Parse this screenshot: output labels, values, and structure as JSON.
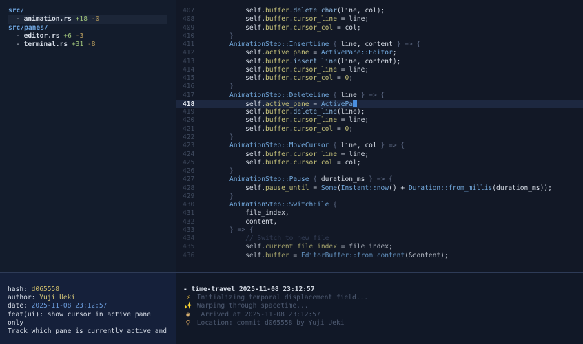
{
  "file_tree": [
    {
      "type": "dir",
      "name": "src/"
    },
    {
      "type": "file",
      "name": "animation.rs",
      "added": "+18",
      "removed": "-0",
      "selected": true
    },
    {
      "type": "dir",
      "name": "src/panes/"
    },
    {
      "type": "file",
      "name": "editor.rs",
      "added": "+6",
      "removed": "-3",
      "selected": false
    },
    {
      "type": "file",
      "name": "terminal.rs",
      "added": "+31",
      "removed": "-8",
      "selected": false
    }
  ],
  "tree_dash": "- ",
  "editor": {
    "current_line": "418",
    "lines": [
      {
        "n": "407",
        "i": 16,
        "t": [
          [
            "k",
            "self"
          ],
          [
            "p",
            "."
          ],
          [
            "f",
            "buffer"
          ],
          [
            "p",
            "."
          ],
          [
            "m",
            "delete_char"
          ],
          [
            "p",
            "(line, col);"
          ]
        ]
      },
      {
        "n": "408",
        "i": 16,
        "t": [
          [
            "k",
            "self"
          ],
          [
            "p",
            "."
          ],
          [
            "f",
            "buffer"
          ],
          [
            "p",
            "."
          ],
          [
            "f",
            "cursor_line"
          ],
          [
            "p",
            " = line;"
          ]
        ]
      },
      {
        "n": "409",
        "i": 16,
        "t": [
          [
            "k",
            "self"
          ],
          [
            "p",
            "."
          ],
          [
            "f",
            "buffer"
          ],
          [
            "p",
            "."
          ],
          [
            "f",
            "cursor_col"
          ],
          [
            "p",
            " = col;"
          ]
        ]
      },
      {
        "n": "410",
        "i": 12,
        "t": [
          [
            "d",
            "}"
          ]
        ]
      },
      {
        "n": "411",
        "i": 12,
        "t": [
          [
            "t",
            "AnimationStep::InsertLine"
          ],
          [
            "d",
            " { "
          ],
          [
            "p",
            "line, content"
          ],
          [
            "d",
            " } => {"
          ]
        ]
      },
      {
        "n": "412",
        "i": 16,
        "t": [
          [
            "k",
            "self"
          ],
          [
            "p",
            "."
          ],
          [
            "f",
            "active_pane"
          ],
          [
            "p",
            " = "
          ],
          [
            "t",
            "ActivePane::Editor"
          ],
          [
            "p",
            ";"
          ]
        ]
      },
      {
        "n": "413",
        "i": 16,
        "t": [
          [
            "k",
            "self"
          ],
          [
            "p",
            "."
          ],
          [
            "f",
            "buffer"
          ],
          [
            "p",
            "."
          ],
          [
            "m",
            "insert_line"
          ],
          [
            "p",
            "(line, content);"
          ]
        ]
      },
      {
        "n": "414",
        "i": 16,
        "t": [
          [
            "k",
            "self"
          ],
          [
            "p",
            "."
          ],
          [
            "f",
            "buffer"
          ],
          [
            "p",
            "."
          ],
          [
            "f",
            "cursor_line"
          ],
          [
            "p",
            " = line;"
          ]
        ]
      },
      {
        "n": "415",
        "i": 16,
        "t": [
          [
            "k",
            "self"
          ],
          [
            "p",
            "."
          ],
          [
            "f",
            "buffer"
          ],
          [
            "p",
            "."
          ],
          [
            "f",
            "cursor_col"
          ],
          [
            "p",
            " = "
          ],
          [
            "n",
            "0"
          ],
          [
            "p",
            ";"
          ]
        ]
      },
      {
        "n": "416",
        "i": 12,
        "t": [
          [
            "d",
            "}"
          ]
        ]
      },
      {
        "n": "417",
        "i": 12,
        "t": [
          [
            "t",
            "AnimationStep::DeleteLine"
          ],
          [
            "d",
            " { "
          ],
          [
            "p",
            "line"
          ],
          [
            "d",
            " } => {"
          ]
        ]
      },
      {
        "n": "418",
        "i": 16,
        "t": [
          [
            "k",
            "self"
          ],
          [
            "p",
            "."
          ],
          [
            "f",
            "active_pane"
          ],
          [
            "p",
            " = "
          ],
          [
            "t",
            "ActivePa"
          ]
        ],
        "cursor": true
      },
      {
        "n": "419",
        "i": 16,
        "t": [
          [
            "k",
            "self"
          ],
          [
            "p",
            "."
          ],
          [
            "f",
            "buffer"
          ],
          [
            "p",
            "."
          ],
          [
            "m",
            "delete_line"
          ],
          [
            "p",
            "(line);"
          ]
        ]
      },
      {
        "n": "420",
        "i": 16,
        "t": [
          [
            "k",
            "self"
          ],
          [
            "p",
            "."
          ],
          [
            "f",
            "buffer"
          ],
          [
            "p",
            "."
          ],
          [
            "f",
            "cursor_line"
          ],
          [
            "p",
            " = line;"
          ]
        ]
      },
      {
        "n": "421",
        "i": 16,
        "t": [
          [
            "k",
            "self"
          ],
          [
            "p",
            "."
          ],
          [
            "f",
            "buffer"
          ],
          [
            "p",
            "."
          ],
          [
            "f",
            "cursor_col"
          ],
          [
            "p",
            " = "
          ],
          [
            "n",
            "0"
          ],
          [
            "p",
            ";"
          ]
        ]
      },
      {
        "n": "422",
        "i": 12,
        "t": [
          [
            "d",
            "}"
          ]
        ]
      },
      {
        "n": "423",
        "i": 12,
        "t": [
          [
            "t",
            "AnimationStep::MoveCursor"
          ],
          [
            "d",
            " { "
          ],
          [
            "p",
            "line, col"
          ],
          [
            "d",
            " } => {"
          ]
        ]
      },
      {
        "n": "424",
        "i": 16,
        "t": [
          [
            "k",
            "self"
          ],
          [
            "p",
            "."
          ],
          [
            "f",
            "buffer"
          ],
          [
            "p",
            "."
          ],
          [
            "f",
            "cursor_line"
          ],
          [
            "p",
            " = line;"
          ]
        ]
      },
      {
        "n": "425",
        "i": 16,
        "t": [
          [
            "k",
            "self"
          ],
          [
            "p",
            "."
          ],
          [
            "f",
            "buffer"
          ],
          [
            "p",
            "."
          ],
          [
            "f",
            "cursor_col"
          ],
          [
            "p",
            " = col;"
          ]
        ]
      },
      {
        "n": "426",
        "i": 12,
        "t": [
          [
            "d",
            "}"
          ]
        ]
      },
      {
        "n": "427",
        "i": 12,
        "t": [
          [
            "t",
            "AnimationStep::Pause"
          ],
          [
            "d",
            " { "
          ],
          [
            "p",
            "duration_ms"
          ],
          [
            "d",
            " } => {"
          ]
        ]
      },
      {
        "n": "428",
        "i": 16,
        "t": [
          [
            "k",
            "self"
          ],
          [
            "p",
            "."
          ],
          [
            "f",
            "pause_until"
          ],
          [
            "p",
            " = "
          ],
          [
            "t",
            "Some"
          ],
          [
            "p",
            "("
          ],
          [
            "t",
            "Instant::now"
          ],
          [
            "p",
            "() + "
          ],
          [
            "t",
            "Duration::from_millis"
          ],
          [
            "p",
            "(duration_ms));"
          ]
        ]
      },
      {
        "n": "429",
        "i": 12,
        "t": [
          [
            "d",
            "}"
          ]
        ]
      },
      {
        "n": "430",
        "i": 12,
        "t": [
          [
            "t",
            "AnimationStep::SwitchFile"
          ],
          [
            "d",
            " {"
          ]
        ]
      },
      {
        "n": "431",
        "i": 16,
        "t": [
          [
            "p",
            "file_index,"
          ]
        ]
      },
      {
        "n": "432",
        "i": 16,
        "t": [
          [
            "p",
            "content,"
          ]
        ]
      },
      {
        "n": "433",
        "i": 12,
        "t": [
          [
            "d",
            "} => {"
          ]
        ]
      },
      {
        "n": "434",
        "i": 16,
        "t": [
          [
            "c",
            "// Switch to new file"
          ]
        ]
      },
      {
        "n": "435",
        "i": 16,
        "t": [
          [
            "k",
            "self"
          ],
          [
            "p",
            "."
          ],
          [
            "f",
            "current_file_index"
          ],
          [
            "p",
            " = file_index;"
          ]
        ]
      },
      {
        "n": "436",
        "i": 16,
        "t": [
          [
            "k",
            "self"
          ],
          [
            "p",
            "."
          ],
          [
            "f",
            "buffer"
          ],
          [
            "p",
            " = "
          ],
          [
            "t",
            "EditorBuffer::from_content"
          ],
          [
            "p",
            "(&content);"
          ]
        ]
      }
    ]
  },
  "commit": {
    "hash_label": "hash: ",
    "hash": "d065558",
    "author_label": "author: ",
    "author": "Yuji Ueki",
    "date_label": "date: ",
    "date": "2025-11-08 23:12:57",
    "subject_1": "feat(ui): show cursor in active pane",
    "subject_2": "only",
    "body": "Track which pane is currently active and"
  },
  "terminal": {
    "header": "- time-travel 2025-11-08 23:12:57",
    "lines": [
      {
        "icon": "bolt",
        "glyph": "⚡",
        "text": "Initializing temporal displacement field..."
      },
      {
        "icon": "sparkle",
        "glyph": "✨",
        "text": "Warping through spacetime..."
      },
      {
        "icon": "clock",
        "glyph": "◉",
        "text": " Arrived at 2025-11-08 23:12:57"
      },
      {
        "icon": "pin",
        "glyph": "⚲",
        "text": "Location: commit d065558 by Yuji Ueki"
      }
    ]
  }
}
